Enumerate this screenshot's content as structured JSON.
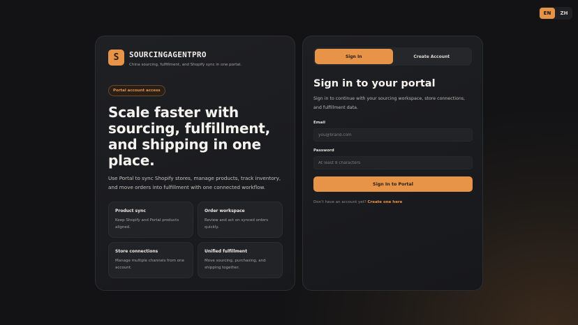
{
  "language": {
    "options": [
      "EN",
      "ZH"
    ],
    "selected": "EN"
  },
  "brand": {
    "logo_letter": "S",
    "name": "SOURCINGAGENTPRO",
    "tagline": "China sourcing, fulfillment, and Shopify sync in one portal."
  },
  "hero": {
    "badge": "Portal account access",
    "title": "Scale faster with sourcing, fulfillment, and shipping in one place.",
    "description": "Use Portal to sync Shopify stores, manage products, track inventory, and move orders into fulfillment with one connected workflow."
  },
  "features": [
    {
      "title": "Product sync",
      "description": "Keep Shopify and Portal products aligned."
    },
    {
      "title": "Order workspace",
      "description": "Review and act on synced orders quickly."
    },
    {
      "title": "Store connections",
      "description": "Manage multiple channels from one account."
    },
    {
      "title": "Unified fulfillment",
      "description": "Move sourcing, purchasing, and shipping together."
    }
  ],
  "auth": {
    "tabs": [
      {
        "label": "Sign In",
        "active": true
      },
      {
        "label": "Create Account",
        "active": false
      }
    ],
    "title": "Sign in to your portal",
    "subtitle": "Sign in to continue with your sourcing workspace, store connections, and fulfillment data.",
    "email": {
      "label": "Email",
      "value": "",
      "placeholder": "you@brand.com"
    },
    "password": {
      "label": "Password",
      "value": "",
      "placeholder": "At least 8 characters"
    },
    "submit_label": "Sign In to Portal",
    "switch_prompt": "Don't have an account yet?",
    "switch_link": "Create one here"
  },
  "colors": {
    "accent": "#e79449",
    "background": "#131315",
    "card": "#1c1d20"
  }
}
